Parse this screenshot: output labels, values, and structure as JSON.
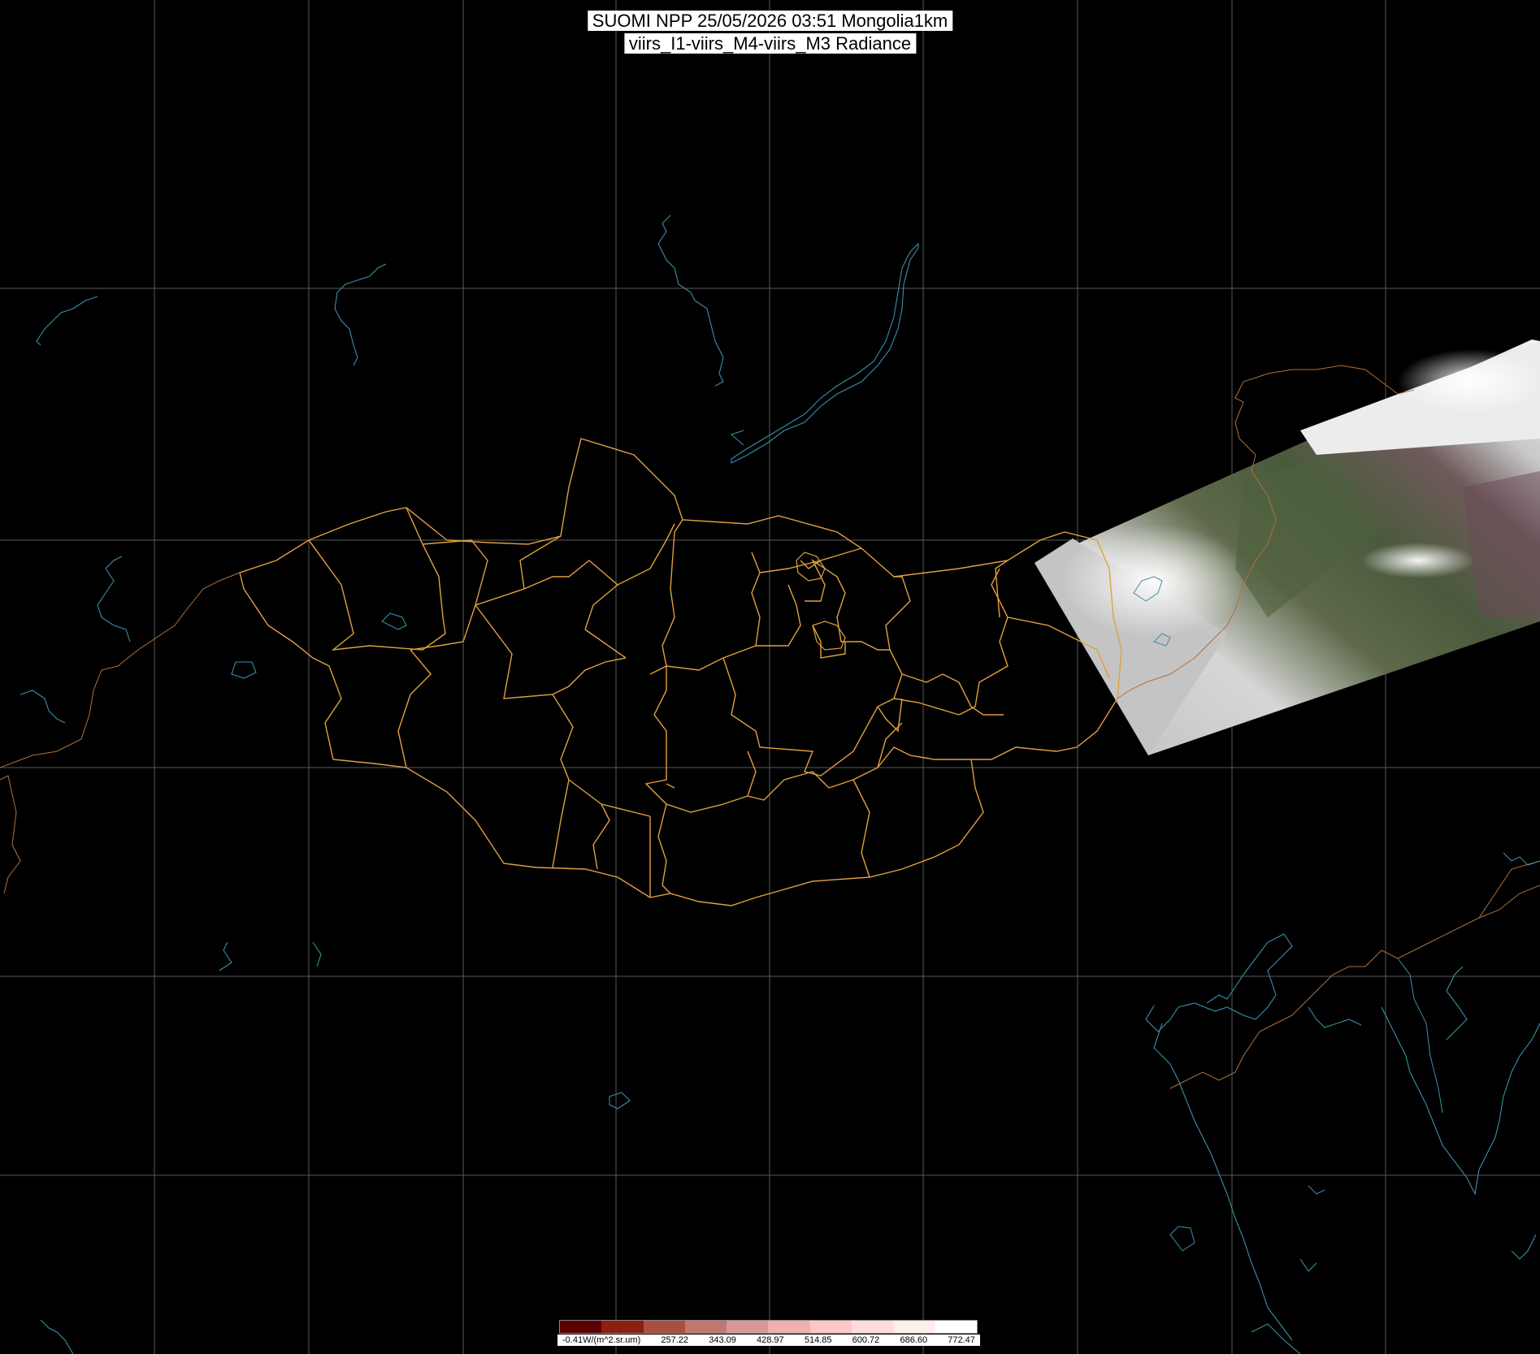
{
  "header": {
    "line1": "SUOMI NPP 25/05/2026 03:51 Mongolia1km",
    "line2": "viirs_I1-viirs_M4-viirs_M3 Radiance"
  },
  "colors": {
    "background": "#000000",
    "grid": "#5a5a5a",
    "province_border": "#e0a040",
    "coast_lake": "#3a8fa8",
    "country_border": "#b0703a"
  },
  "colorbar": {
    "ramp": [
      "#5a0000",
      "#8a2010",
      "#a85040",
      "#c07870",
      "#d89898",
      "#f0b0b0",
      "#ffc8c8",
      "#ffdcdc",
      "#ffeeee",
      "#ffffff"
    ],
    "first_label": "-0.41W/(m^2.sr.um)",
    "values": [
      "257.22",
      "343.09",
      "428.97",
      "514.85",
      "600.72",
      "686.60",
      "772.47"
    ]
  }
}
